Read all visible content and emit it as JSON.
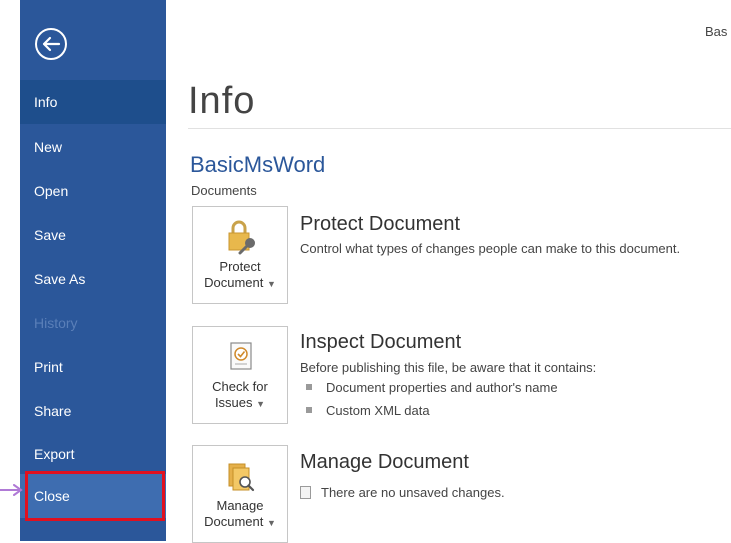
{
  "window": {
    "title_fragment": "Bas"
  },
  "sidebar": {
    "back_icon": "back-arrow-icon",
    "items": [
      {
        "label": "Info",
        "state": "selected"
      },
      {
        "label": "New",
        "state": "normal"
      },
      {
        "label": "Open",
        "state": "normal"
      },
      {
        "label": "Save",
        "state": "normal"
      },
      {
        "label": "Save As",
        "state": "normal"
      },
      {
        "label": "History",
        "state": "disabled"
      },
      {
        "label": "Print",
        "state": "normal"
      },
      {
        "label": "Share",
        "state": "normal"
      },
      {
        "label": "Export",
        "state": "normal"
      },
      {
        "label": "Close",
        "state": "hover"
      }
    ]
  },
  "main": {
    "title": "Info",
    "doc_name": "BasicMsWord",
    "doc_location": "Documents",
    "sections": [
      {
        "tile_label_line1": "Protect",
        "tile_label_line2": "Document",
        "title": "Protect Document",
        "description": "Control what types of changes people can make to this document."
      },
      {
        "tile_label_line1": "Check for",
        "tile_label_line2": "Issues",
        "title": "Inspect Document",
        "description": "Before publishing this file, be aware that it contains:",
        "bullets": [
          "Document properties and author's name",
          "Custom XML data"
        ]
      },
      {
        "tile_label_line1": "Manage",
        "tile_label_line2": "Document",
        "title": "Manage Document",
        "note": "There are no unsaved changes."
      }
    ]
  },
  "colors": {
    "sidebar": "#2b579a",
    "accent_title": "#2b579a",
    "highlight_box": "#e0101f",
    "pointer": "#b07ad6"
  }
}
